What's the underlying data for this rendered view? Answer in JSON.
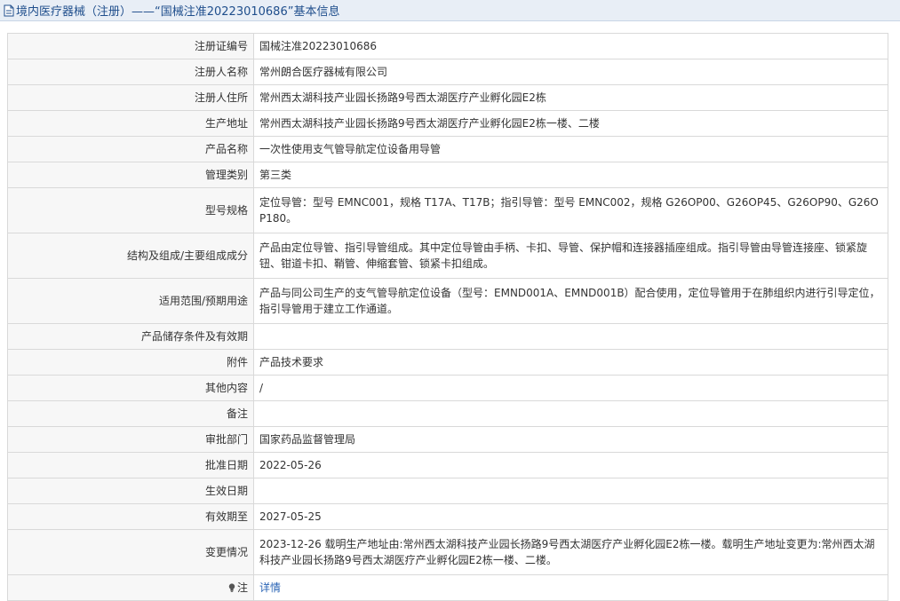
{
  "header": {
    "title": "境内医疗器械（注册）——“国械注准20223010686”基本信息"
  },
  "rows": [
    {
      "label": "注册证编号",
      "value": "国械注准20223010686"
    },
    {
      "label": "注册人名称",
      "value": "常州朗合医疗器械有限公司"
    },
    {
      "label": "注册人住所",
      "value": "常州西太湖科技产业园长扬路9号西太湖医疗产业孵化园E2栋"
    },
    {
      "label": "生产地址",
      "value": "常州西太湖科技产业园长扬路9号西太湖医疗产业孵化园E2栋一楼、二楼"
    },
    {
      "label": "产品名称",
      "value": "一次性使用支气管导航定位设备用导管"
    },
    {
      "label": "管理类别",
      "value": "第三类"
    },
    {
      "label": "型号规格",
      "value": "定位导管：型号 EMNC001，规格 T17A、T17B；指引导管：型号 EMNC002，规格 G26OP00、G26OP45、G26OP90、G26OP180。"
    },
    {
      "label": "结构及组成/主要组成成分",
      "value": "产品由定位导管、指引导管组成。其中定位导管由手柄、卡扣、导管、保护帽和连接器插座组成。指引导管由导管连接座、锁紧旋钮、钳道卡扣、鞘管、伸缩套管、锁紧卡扣组成。"
    },
    {
      "label": "适用范围/预期用途",
      "value": "产品与同公司生产的支气管导航定位设备（型号：EMND001A、EMND001B）配合使用，定位导管用于在肺组织内进行引导定位，指引导管用于建立工作通道。"
    },
    {
      "label": "产品储存条件及有效期",
      "value": ""
    },
    {
      "label": "附件",
      "value": "产品技术要求"
    },
    {
      "label": "其他内容",
      "value": "/"
    },
    {
      "label": "备注",
      "value": ""
    },
    {
      "label": "审批部门",
      "value": "国家药品监督管理局"
    },
    {
      "label": "批准日期",
      "value": "2022-05-26"
    },
    {
      "label": "生效日期",
      "value": ""
    },
    {
      "label": "有效期至",
      "value": "2027-05-25"
    },
    {
      "label": "变更情况",
      "value": "2023-12-26 载明生产地址由:常州西太湖科技产业园长扬路9号西太湖医疗产业孵化园E2栋一楼。载明生产地址变更为:常州西太湖科技产业园长扬路9号西太湖医疗产业孵化园E2栋一楼、二楼。"
    }
  ],
  "note": {
    "label": "注",
    "icon": "lightbulb-icon",
    "link_text": "详情"
  }
}
